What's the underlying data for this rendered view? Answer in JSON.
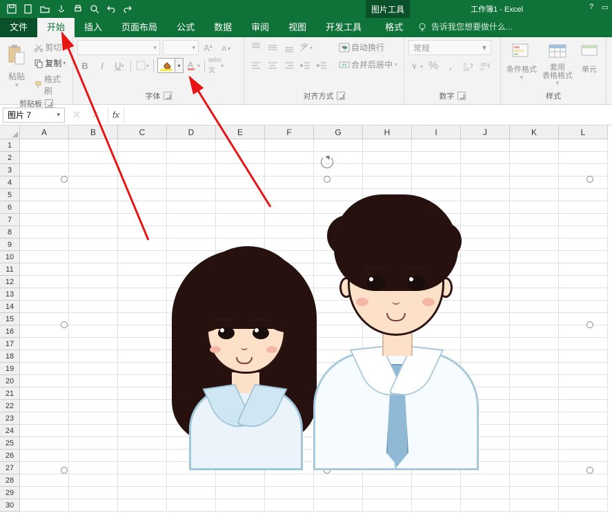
{
  "app": {
    "title": "工作簿1 - Excel",
    "context_tab": "图片工具"
  },
  "tabs": {
    "file": "文件",
    "home": "开始",
    "insert": "插入",
    "layout": "页面布局",
    "formulas": "公式",
    "data": "数据",
    "review": "审阅",
    "view": "视图",
    "dev": "开发工具",
    "format": "格式"
  },
  "tell_me": "告诉我您想要做什么...",
  "ribbon": {
    "clipboard": {
      "label": "剪贴板",
      "paste": "粘贴",
      "cut": "剪切",
      "copy": "复制",
      "painter": "格式刷"
    },
    "font": {
      "label": "字体",
      "bold": "B",
      "italic": "I",
      "underline": "U",
      "wen": "wén 文"
    },
    "align": {
      "label": "对齐方式",
      "wrap": "自动换行",
      "merge": "合并后居中"
    },
    "number": {
      "label": "数字",
      "format": "常规"
    },
    "styles": {
      "label": "样式",
      "cond": "条件格式",
      "table": "套用\n表格格式",
      "cell": "单元"
    }
  },
  "namebox": "图片 7",
  "columns": [
    "A",
    "B",
    "C",
    "D",
    "E",
    "F",
    "G",
    "H",
    "I",
    "J",
    "K",
    "L"
  ],
  "rows": [
    "1",
    "2",
    "3",
    "4",
    "5",
    "6",
    "7",
    "8",
    "9",
    "10",
    "11",
    "12",
    "13",
    "14",
    "15",
    "16",
    "17",
    "18",
    "19",
    "20",
    "21",
    "22",
    "23",
    "24",
    "25",
    "26",
    "27",
    "28",
    "29",
    "30"
  ]
}
